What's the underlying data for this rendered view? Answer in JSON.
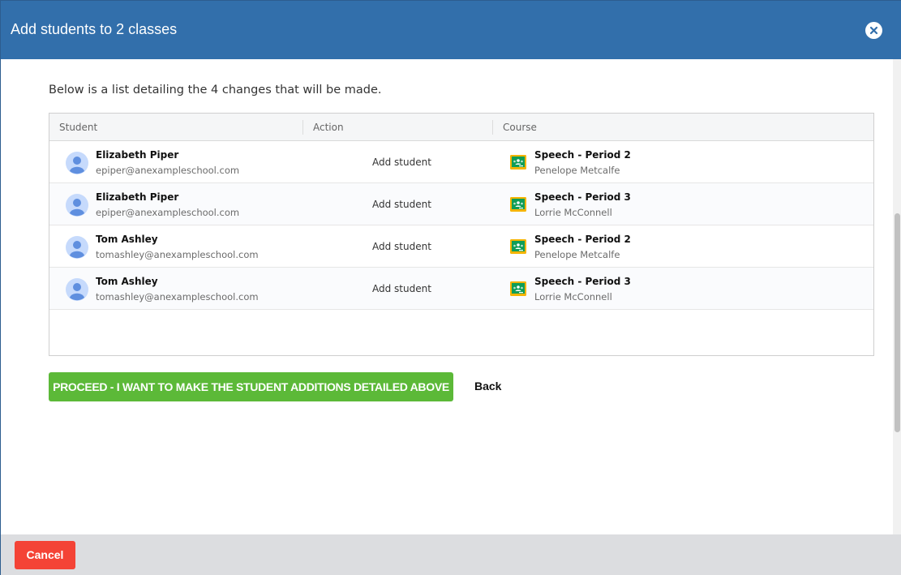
{
  "dialog": {
    "title": "Add students to 2 classes",
    "close_icon": "close-icon"
  },
  "intro_text": "Below is a list detailing the 4 changes that will be made.",
  "table": {
    "columns": [
      "Student",
      "Action",
      "Course"
    ],
    "rows": [
      {
        "student_name": "Elizabeth Piper",
        "student_email": "epiper@anexampleschool.com",
        "action": "Add student",
        "course_name": "Speech - Period 2",
        "teacher": "Penelope Metcalfe"
      },
      {
        "student_name": "Elizabeth Piper",
        "student_email": "epiper@anexampleschool.com",
        "action": "Add student",
        "course_name": "Speech - Period 3",
        "teacher": "Lorrie McConnell"
      },
      {
        "student_name": "Tom Ashley",
        "student_email": "tomashley@anexampleschool.com",
        "action": "Add student",
        "course_name": "Speech - Period 2",
        "teacher": "Penelope Metcalfe"
      },
      {
        "student_name": "Tom Ashley",
        "student_email": "tomashley@anexampleschool.com",
        "action": "Add student",
        "course_name": "Speech - Period 3",
        "teacher": "Lorrie McConnell"
      }
    ]
  },
  "buttons": {
    "proceed": "PROCEED - I WANT TO MAKE THE STUDENT ADDITIONS DETAILED ABOVE",
    "back": "Back",
    "cancel": "Cancel"
  },
  "icons": {
    "avatar": "user-avatar-icon",
    "course": "google-classroom-icon"
  },
  "colors": {
    "header": "#326fab",
    "proceed": "#5cb938",
    "cancel": "#f44336",
    "footer": "#dcdde0"
  }
}
